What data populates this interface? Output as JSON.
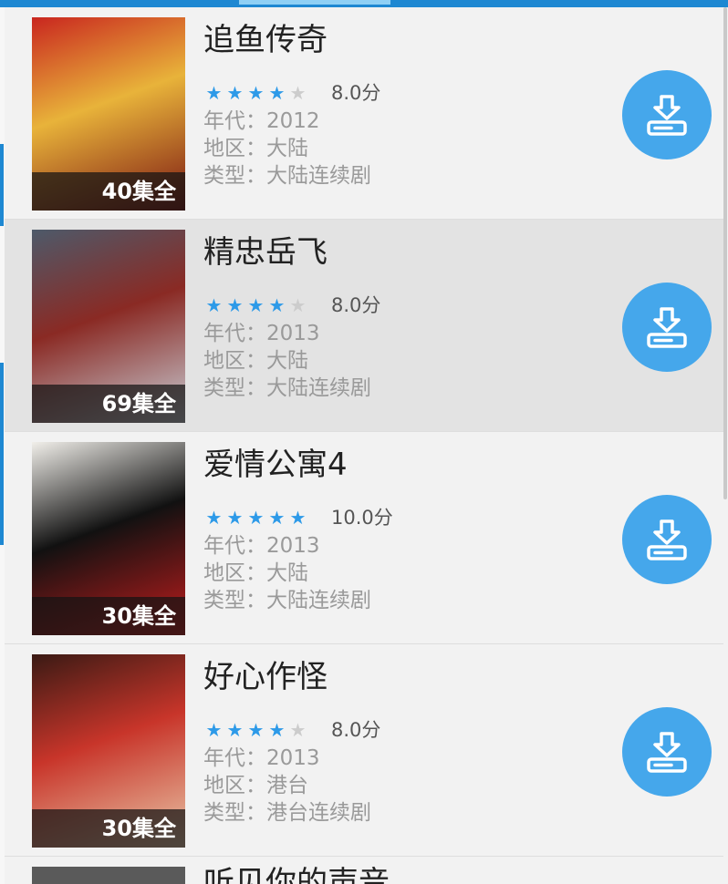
{
  "colors": {
    "accent": "#1e88d2",
    "star_on": "#2d9ae8",
    "star_off": "#cccccc",
    "download_button": "#45a7eb"
  },
  "items": [
    {
      "title": "追鱼传奇",
      "stars_filled": 4,
      "stars_total": 5,
      "score": "8.0分",
      "year": "年代：2012",
      "region": "地区：大陆",
      "genre": "类型：大陆连续剧",
      "episodes": "40集全",
      "poster_colors": [
        "#c9261f",
        "#e8b33a",
        "#7a1512"
      ],
      "download_icon": "download-icon"
    },
    {
      "title": "精忠岳飞",
      "stars_filled": 4,
      "stars_total": 5,
      "score": "8.0分",
      "year": "年代：2013",
      "region": "地区：大陆",
      "genre": "类型：大陆连续剧",
      "episodes": "69集全",
      "poster_colors": [
        "#4d5a6a",
        "#8a2a24",
        "#c9ced6"
      ],
      "download_icon": "download-icon"
    },
    {
      "title": "爱情公寓4",
      "stars_filled": 5,
      "stars_total": 5,
      "score": "10.0分",
      "year": "年代：2013",
      "region": "地区：大陆",
      "genre": "类型：大陆连续剧",
      "episodes": "30集全",
      "poster_colors": [
        "#f1efea",
        "#111111",
        "#c41d1d"
      ],
      "download_icon": "download-icon"
    },
    {
      "title": "好心作怪",
      "stars_filled": 4,
      "stars_total": 5,
      "score": "8.0分",
      "year": "年代：2013",
      "region": "地区：港台",
      "genre": "类型：港台连续剧",
      "episodes": "30集全",
      "poster_colors": [
        "#3a1a14",
        "#c8352a",
        "#e9c7a8"
      ],
      "download_icon": "download-icon"
    }
  ],
  "partial_item": {
    "title": "听见你的声音"
  }
}
